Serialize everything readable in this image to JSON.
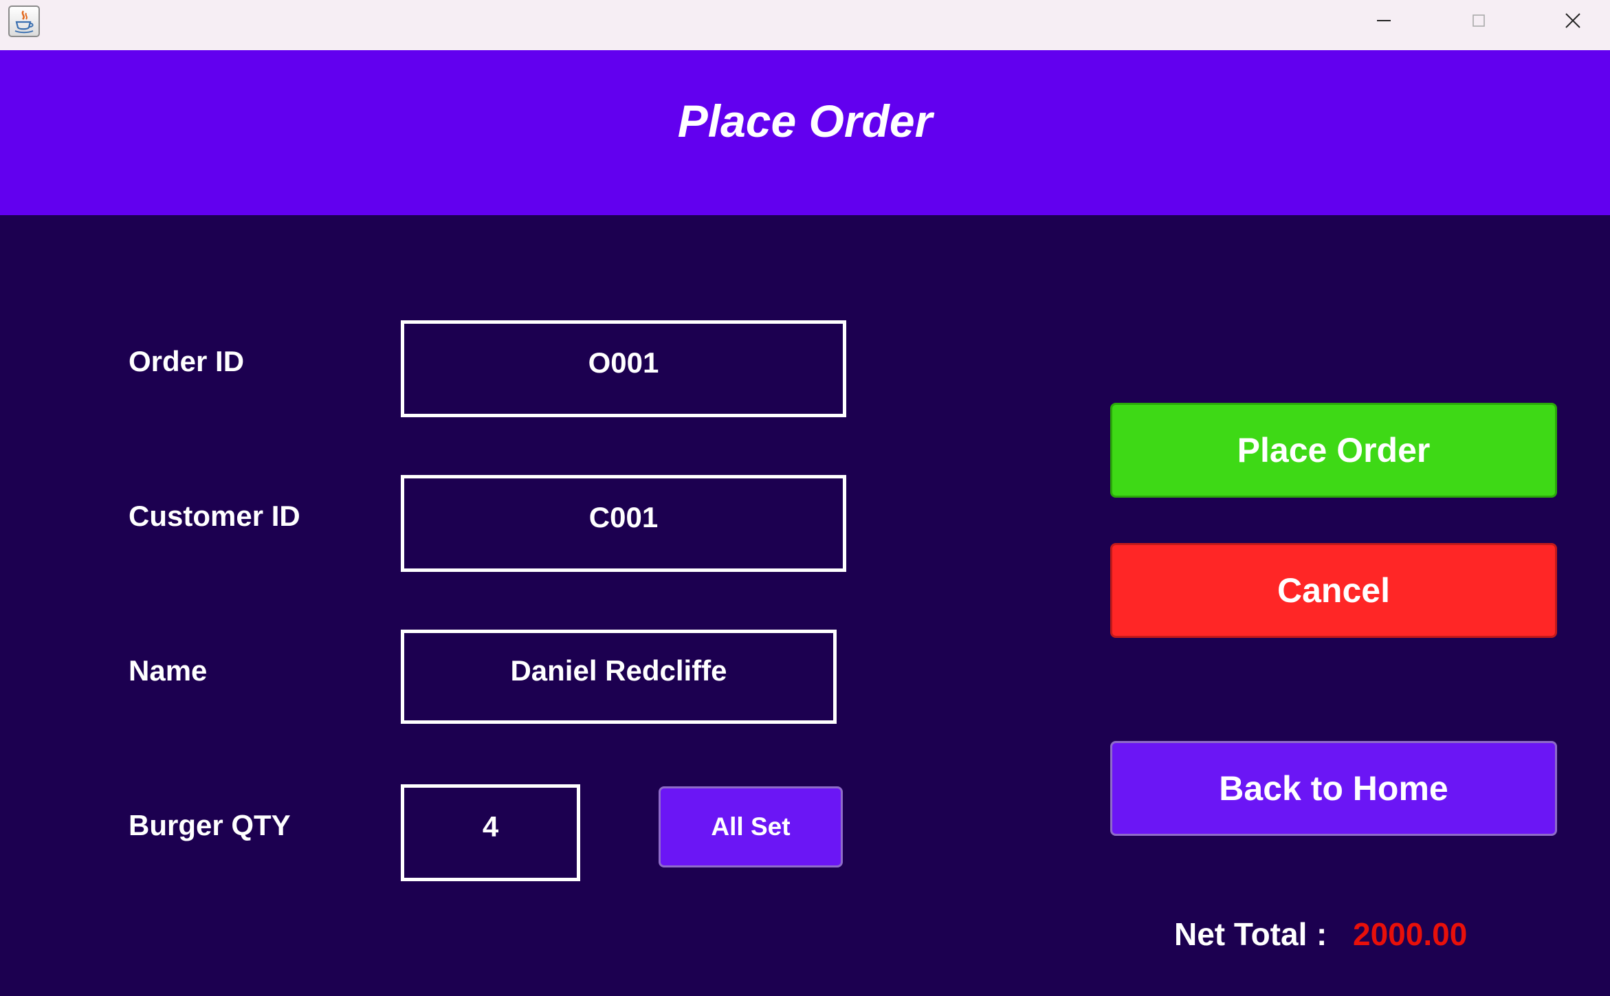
{
  "window": {
    "minimize_icon": "minimize-icon",
    "maximize_icon": "maximize-icon",
    "close_icon": "close-icon",
    "app_icon": "java-coffee-icon"
  },
  "header": {
    "title": "Place Order"
  },
  "form": {
    "order_id": {
      "label": "Order ID",
      "value": "O001"
    },
    "customer_id": {
      "label": "Customer ID",
      "value": "C001"
    },
    "name": {
      "label": "Name",
      "value": "Daniel Redcliffe"
    },
    "burger_qty": {
      "label": "Burger QTY",
      "value": "4"
    },
    "all_set_label": "All Set"
  },
  "actions": {
    "place_order_label": "Place Order",
    "cancel_label": "Cancel",
    "back_home_label": "Back to Home"
  },
  "summary": {
    "net_total_label": "Net Total",
    "separator": ":",
    "net_total_value": "2000.00"
  },
  "colors": {
    "background": "#1c0050",
    "header": "#6200ef",
    "place_order": "#3ed916",
    "cancel": "#ff2626",
    "purple_button": "#6b16f5",
    "net_total_value": "#e8100a"
  }
}
